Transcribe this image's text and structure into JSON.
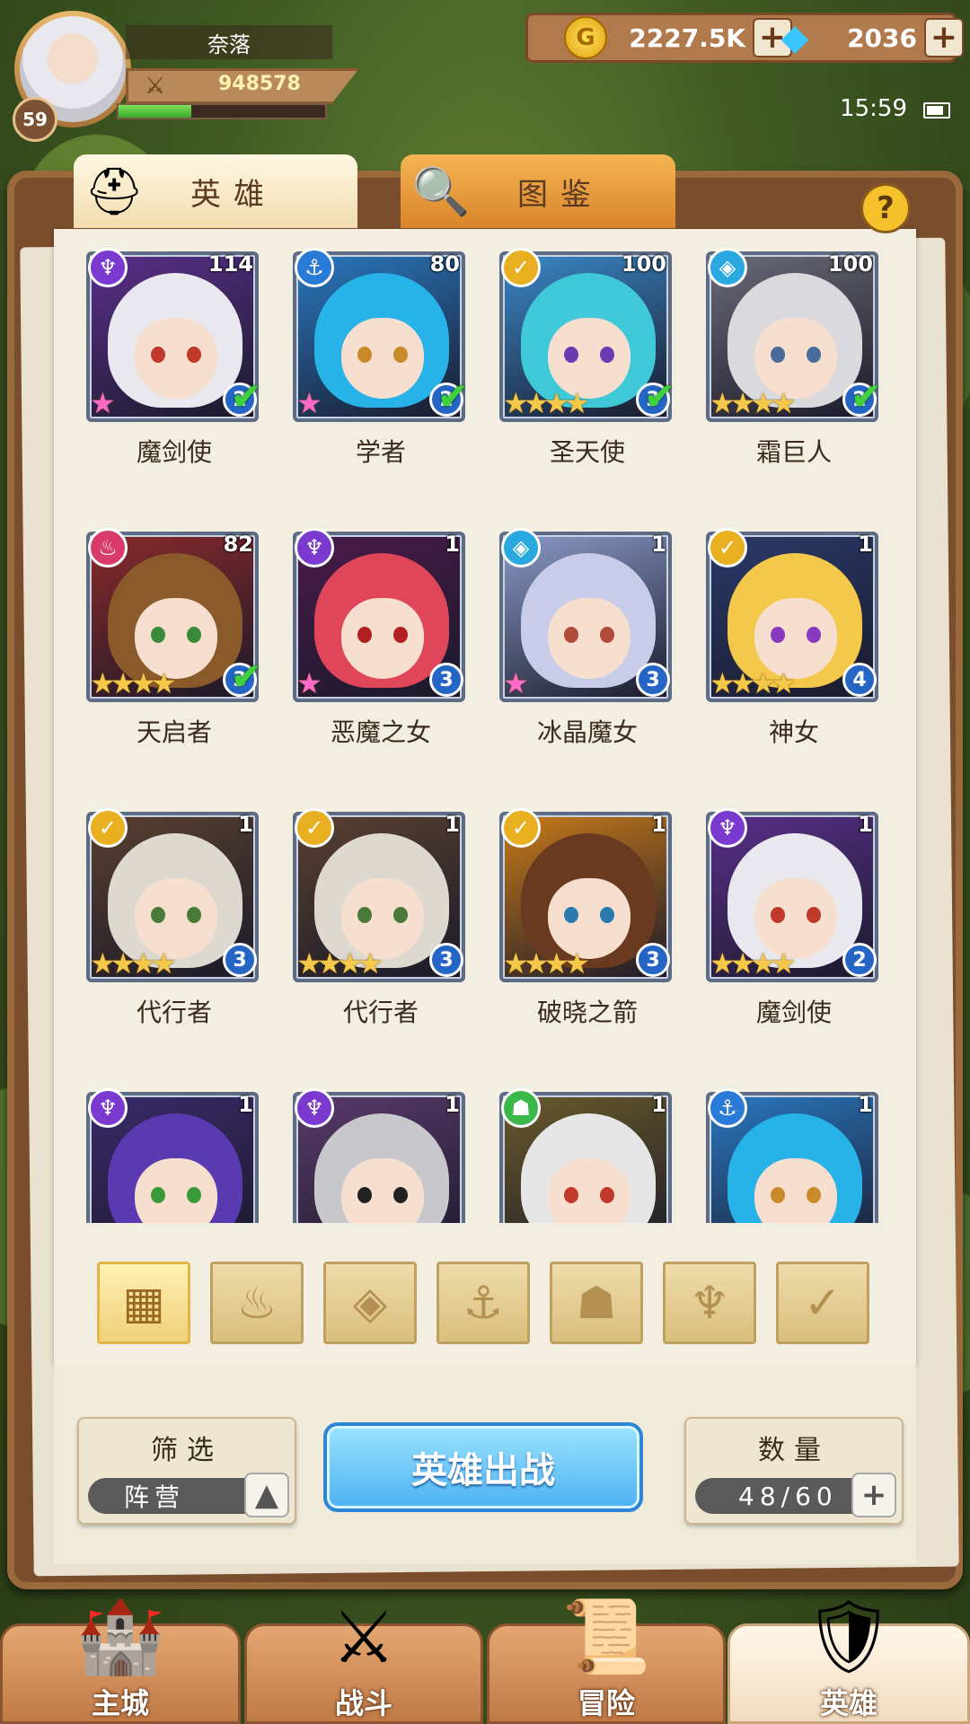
{
  "player": {
    "name": "奈落",
    "level": "59",
    "power": "948578",
    "exp_fraction": 0.35
  },
  "currency": {
    "gold": "2227.5K",
    "gems": "2036"
  },
  "status": {
    "time": "15:59"
  },
  "tabs": [
    {
      "label": "英雄",
      "icon": "helmet-icon"
    },
    {
      "label": "图鉴",
      "icon": "magnifier-icon"
    }
  ],
  "heroes": [
    {
      "name": "魔剑使",
      "level": "114",
      "faction": "demon",
      "stars": 1,
      "rainbow": true,
      "rank": "2",
      "checked": true,
      "hair": "#e8e8ee",
      "eye": "#c0392b",
      "bg": "#5a2f8a"
    },
    {
      "name": "学者",
      "level": "80",
      "faction": "anchor",
      "stars": 1,
      "rainbow": true,
      "rank": "2",
      "checked": true,
      "hair": "#27b2e8",
      "eye": "#c98a2a",
      "bg": "#2a78c0"
    },
    {
      "name": "圣天使",
      "level": "100",
      "faction": "holy",
      "stars": 4,
      "rainbow": false,
      "rank": "3",
      "checked": true,
      "hair": "#3fc9d8",
      "eye": "#6a3ab0",
      "bg": "#3a88c8"
    },
    {
      "name": "霜巨人",
      "level": "100",
      "faction": "frost",
      "stars": 4,
      "rainbow": false,
      "rank": "2",
      "checked": true,
      "hair": "#d9d9de",
      "eye": "#4a6a9a",
      "bg": "#6a6a78"
    },
    {
      "name": "天启者",
      "level": "82",
      "faction": "fire",
      "stars": 4,
      "rainbow": false,
      "rank": "3",
      "checked": true,
      "hair": "#8a5a2a",
      "eye": "#3a8a3a",
      "bg": "#8a2a2a"
    },
    {
      "name": "恶魔之女",
      "level": "1",
      "faction": "demon",
      "stars": 1,
      "rainbow": true,
      "rank": "3",
      "checked": false,
      "hair": "#e0465a",
      "eye": "#b02020",
      "bg": "#4a1a4a"
    },
    {
      "name": "冰晶魔女",
      "level": "1",
      "faction": "frost",
      "stars": 1,
      "rainbow": true,
      "rank": "3",
      "checked": false,
      "hair": "#c8cce8",
      "eye": "#b04a3a",
      "bg": "#8a9ac8"
    },
    {
      "name": "神女",
      "level": "1",
      "faction": "holy",
      "stars": 4,
      "rainbow": false,
      "rank": "4",
      "checked": false,
      "hair": "#f4c84a",
      "eye": "#8a3ac0",
      "bg": "#2a3a6a"
    },
    {
      "name": "代行者",
      "level": "1",
      "faction": "holy",
      "stars": 4,
      "rainbow": false,
      "rank": "3",
      "checked": false,
      "hair": "#ddd8d0",
      "eye": "#4a7a3a",
      "bg": "#5a4030"
    },
    {
      "name": "代行者",
      "level": "1",
      "faction": "holy",
      "stars": 4,
      "rainbow": false,
      "rank": "3",
      "checked": false,
      "hair": "#ddd8d0",
      "eye": "#4a7a3a",
      "bg": "#5a4030"
    },
    {
      "name": "破晓之箭",
      "level": "1",
      "faction": "holy",
      "stars": 4,
      "rainbow": false,
      "rank": "3",
      "checked": false,
      "hair": "#6a3a20",
      "eye": "#2a7ab0",
      "bg": "#c87a1a"
    },
    {
      "name": "魔剑使",
      "level": "1",
      "faction": "demon",
      "stars": 4,
      "rainbow": false,
      "rank": "2",
      "checked": false,
      "hair": "#e8e8ee",
      "eye": "#c0392b",
      "bg": "#5a2f8a"
    },
    {
      "name": "",
      "level": "1",
      "faction": "demon",
      "stars": 0,
      "rainbow": false,
      "rank": "",
      "checked": false,
      "hair": "#5a3ab0",
      "eye": "#3a9a3a",
      "bg": "#3a2a6a"
    },
    {
      "name": "",
      "level": "1",
      "faction": "demon",
      "stars": 0,
      "rainbow": false,
      "rank": "",
      "checked": false,
      "hair": "#c8c8cc",
      "eye": "#222222",
      "bg": "#5a3a6a"
    },
    {
      "name": "",
      "level": "1",
      "faction": "beast",
      "stars": 0,
      "rainbow": false,
      "rank": "",
      "checked": false,
      "hair": "#e6e6e6",
      "eye": "#c0392b",
      "bg": "#6a5a2a"
    },
    {
      "name": "",
      "level": "1",
      "faction": "anchor",
      "stars": 0,
      "rainbow": false,
      "rank": "",
      "checked": false,
      "hair": "#27b2e8",
      "eye": "#c98a2a",
      "bg": "#2a78c0"
    }
  ],
  "faction_colors": {
    "demon": "#7a3ad0",
    "anchor": "#2a7ad8",
    "holy": "#e8b020",
    "frost": "#2aa8e0",
    "fire": "#d83a6a",
    "beast": "#3ab84a"
  },
  "faction_glyphs": {
    "demon": "♆",
    "anchor": "⚓",
    "holy": "✓",
    "frost": "◈",
    "fire": "♨",
    "beast": "☗"
  },
  "filters": [
    {
      "name": "all",
      "glyph": "▦",
      "active": true
    },
    {
      "name": "fire",
      "glyph": "♨",
      "active": false
    },
    {
      "name": "frost",
      "glyph": "◈",
      "active": false
    },
    {
      "name": "anchor",
      "glyph": "⚓",
      "active": false
    },
    {
      "name": "beast",
      "glyph": "☗",
      "active": false
    },
    {
      "name": "demon",
      "glyph": "♆",
      "active": false
    },
    {
      "name": "holy",
      "glyph": "✓",
      "active": false
    }
  ],
  "controls": {
    "filter_title": "筛选",
    "filter_value": "阵营",
    "deploy_label": "英雄出战",
    "count_title": "数量",
    "count_value": "48/60"
  },
  "nav": [
    {
      "label": "主城",
      "icon": "castle-icon"
    },
    {
      "label": "战斗",
      "icon": "crossed-swords-icon"
    },
    {
      "label": "冒险",
      "icon": "map-scroll-icon"
    },
    {
      "label": "英雄",
      "icon": "hero-helmet-icon",
      "active": true
    }
  ]
}
